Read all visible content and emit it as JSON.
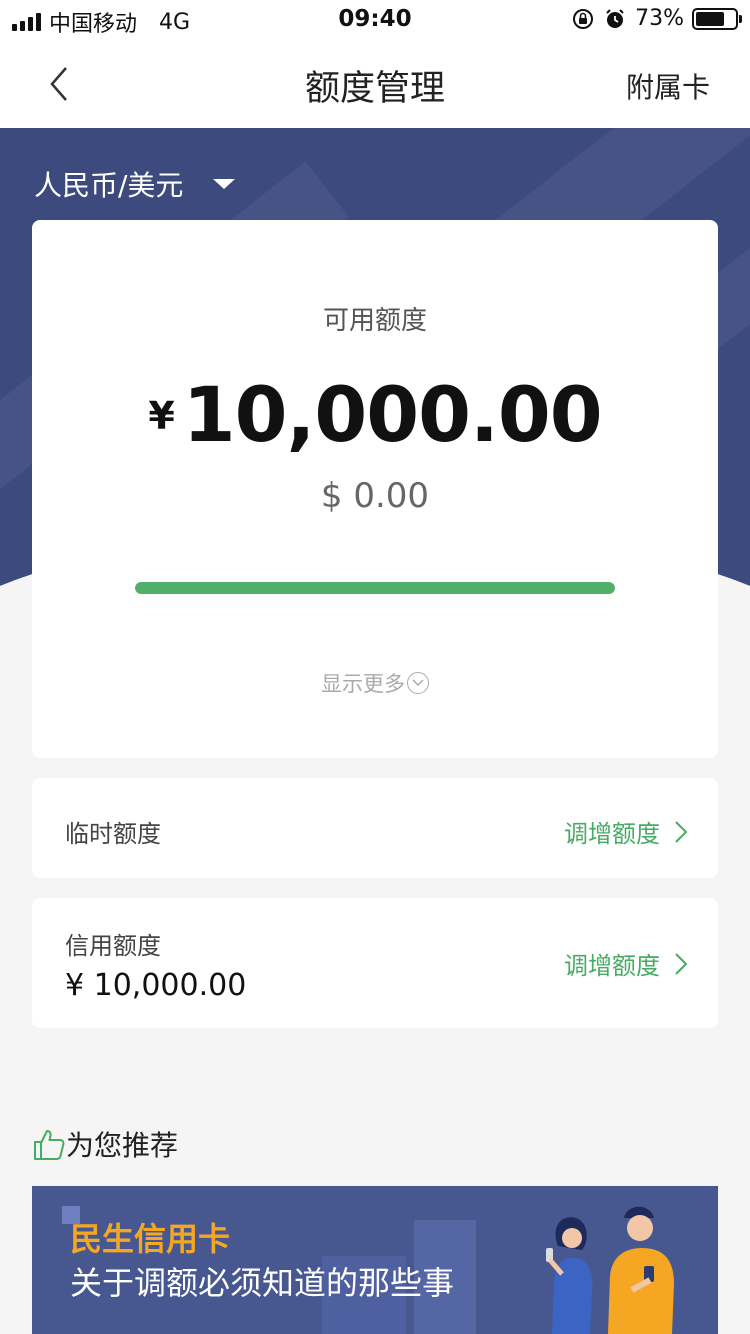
{
  "status_bar": {
    "carrier": "中国移动",
    "network": "4G",
    "time": "09:40",
    "battery": "73%",
    "battery_level": 0.73
  },
  "nav": {
    "title": "额度管理",
    "right_action": "附属卡"
  },
  "currency_selector": {
    "value": "人民币/美元"
  },
  "available": {
    "label": "可用额度",
    "currency_symbol": "¥",
    "amount": "10,000.00",
    "usd_amount": "$ 0.00",
    "usage_fraction": 1.0,
    "show_more": "显示更多"
  },
  "temp_limit": {
    "label": "临时额度",
    "action": "调增额度"
  },
  "credit_limit": {
    "label": "信用额度",
    "value": "¥ 10,000.00",
    "action": "调增额度"
  },
  "recommend": {
    "title": "为您推荐",
    "banner_brand": "民生信用卡",
    "banner_text": "关于调额必须知道的那些事"
  },
  "colors": {
    "hero_bg": "#3d4a7e",
    "accent_green": "#48ab64",
    "progress_green": "#50b06a",
    "banner_bg": "#475891",
    "banner_brand": "#f5a623"
  }
}
